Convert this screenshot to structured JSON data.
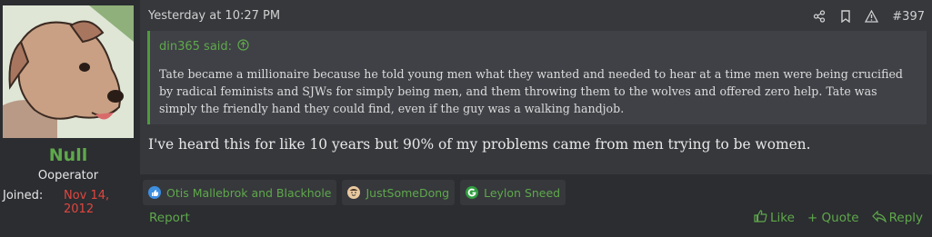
{
  "user": {
    "name": "Null",
    "title": "Ooperator",
    "joined_label": "Joined:",
    "joined_value": "Nov 14, 2012"
  },
  "post": {
    "date": "Yesterday at 10:27 PM",
    "number": "#397",
    "quote": {
      "author": "din365 said:",
      "text": "Tate became a millionaire because he told young men what they wanted and needed to hear at a time men were being crucified by radical feminists and SJWs for simply being men, and them throwing them to the wolves and offered zero help. Tate was simply the friendly hand they could find, even if the guy was a walking handjob."
    },
    "body": "I've heard this for like 10 years but 90% of my problems came from men trying to be women."
  },
  "reactions": [
    {
      "icon": "like-icon",
      "label": "Otis Mallebrok and Blackhole"
    },
    {
      "icon": "face-icon",
      "label": "JustSomeDong"
    },
    {
      "icon": "g-icon",
      "label": "Leylon Sneed"
    }
  ],
  "footer": {
    "report": "Report",
    "like": "Like",
    "quote": "+ Quote",
    "reply": "Reply"
  },
  "colors": {
    "accent": "#5fa84b",
    "joined_date": "#e0463e",
    "background": "#2b2d31",
    "message_bg": "#36383c",
    "quote_bg": "#3f4146"
  }
}
